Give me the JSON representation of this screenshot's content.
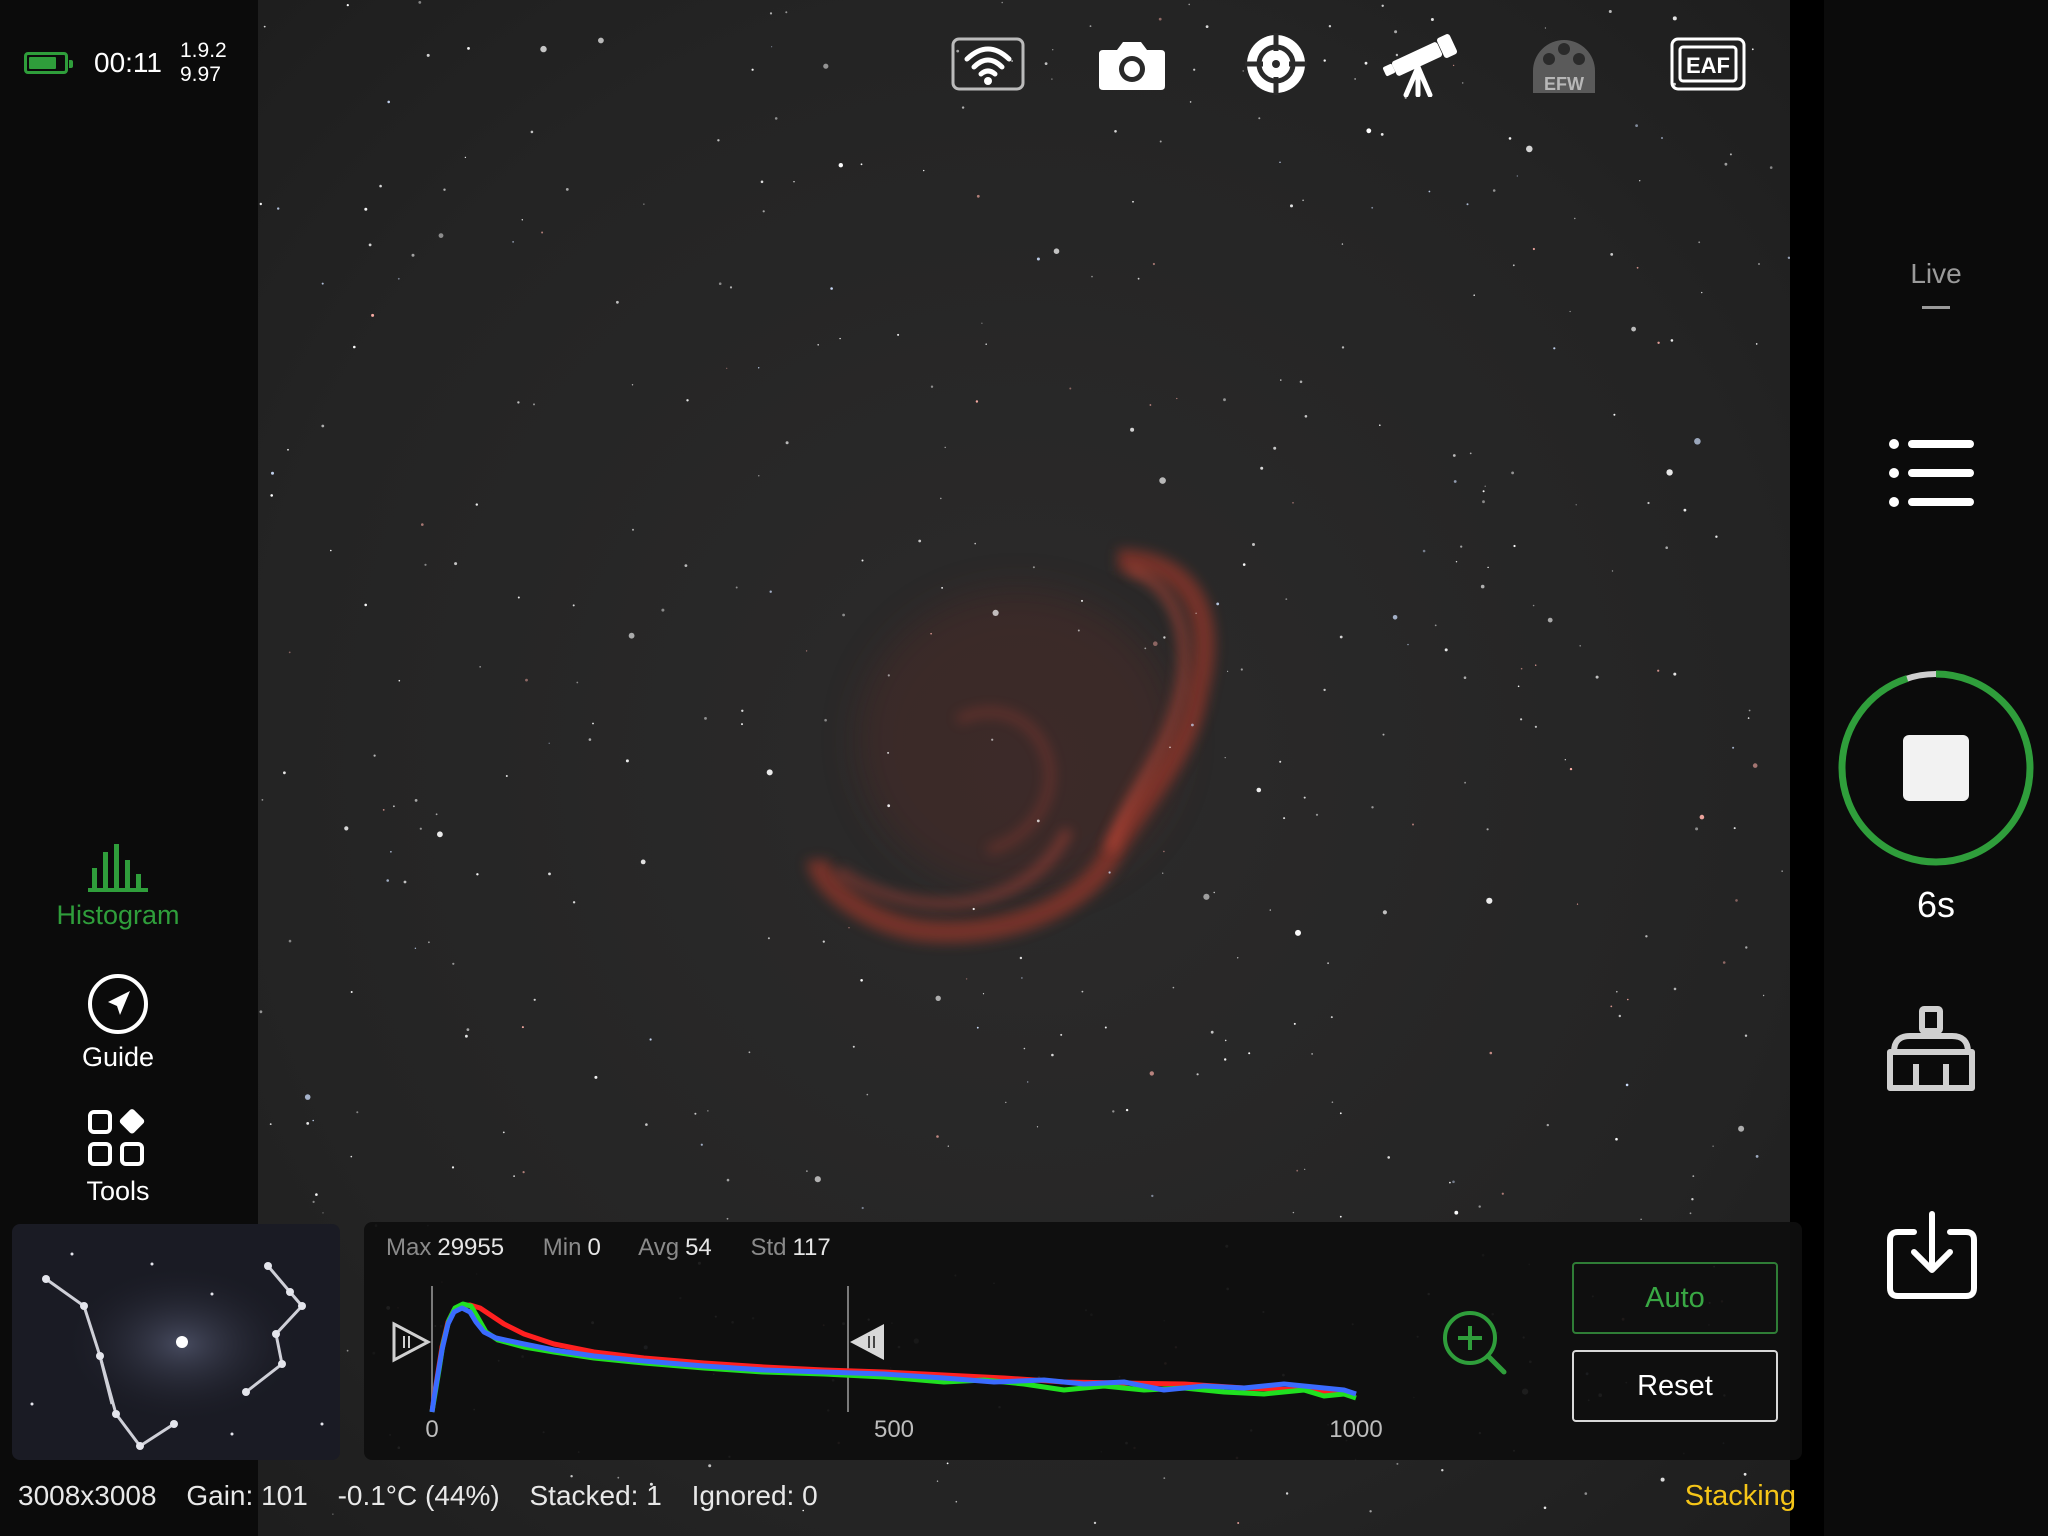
{
  "status": {
    "battery_level": 0.8,
    "time": "00:11",
    "version_line1": "1.9.2",
    "version_line2": "9.97"
  },
  "left_tools": [
    {
      "label": "Histogram",
      "icon": "histogram-icon",
      "active": true
    },
    {
      "label": "Guide",
      "icon": "compass-icon"
    },
    {
      "label": "Tools",
      "icon": "tools-grid-icon"
    }
  ],
  "toolbar": [
    {
      "name": "wifi-icon"
    },
    {
      "name": "camera-icon"
    },
    {
      "name": "crosshair-target-icon"
    },
    {
      "name": "telescope-icon"
    },
    {
      "name": "efw-filter-wheel-icon",
      "text": "EFW"
    },
    {
      "name": "eaf-focuser-icon",
      "text": "EAF"
    },
    {
      "name": "usb-power-icon"
    },
    {
      "name": "info-icon"
    }
  ],
  "histogram": {
    "max_label": "Max",
    "max_value": "29955",
    "min_label": "Min",
    "min_value": "0",
    "avg_label": "Avg",
    "avg_value": "54",
    "std_label": "Std",
    "std_value": "117",
    "axis_ticks": [
      "0",
      "500",
      "1000"
    ],
    "auto_label": "Auto",
    "reset_label": "Reset"
  },
  "bottom_status": {
    "resolution": "3008x3008",
    "gain": "Gain: 101",
    "temperature": "-0.1°C (44%)",
    "stacked": "Stacked: 1",
    "ignored": "Ignored: 0",
    "mode": "Stacking"
  },
  "right_panel": {
    "live_label": "Live",
    "exposure": "6s",
    "exposure_progress": 0.95
  },
  "colors": {
    "accent_green": "#2f9e3b",
    "stacking_yellow": "#f5c518",
    "hist_red": "#ff2020",
    "hist_green": "#20e020",
    "hist_blue": "#3a6bff"
  }
}
